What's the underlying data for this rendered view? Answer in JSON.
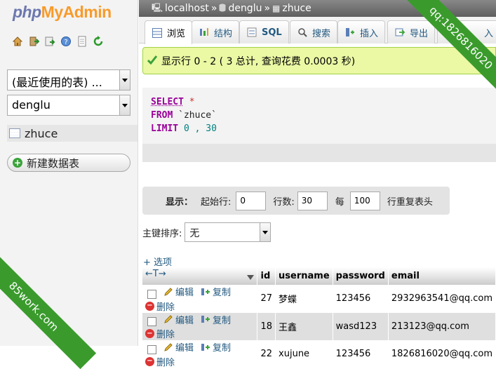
{
  "logo": {
    "php": "php",
    "myadmin": "MyAdmin"
  },
  "sidebar": {
    "icons": [
      "home-icon",
      "exit-icon",
      "query-icon",
      "help-icon",
      "docs-icon",
      "reload-icon"
    ],
    "recent_tables": "(最近使用的表) ...",
    "database": "denglu",
    "table": "zhuce",
    "new_table": "新建数据表"
  },
  "breadcrumb": {
    "server": "localhost",
    "sep1": "»",
    "database": "denglu",
    "sep2": "»",
    "table": "zhuce"
  },
  "tabs": [
    {
      "label": "浏览",
      "icon": "browse-icon"
    },
    {
      "label": "结构",
      "icon": "structure-icon"
    },
    {
      "label": "SQL",
      "icon": "sql-icon"
    },
    {
      "label": "搜索",
      "icon": "search-icon"
    },
    {
      "label": "插入",
      "icon": "insert-icon"
    },
    {
      "label": "导出",
      "icon": "export-icon"
    },
    {
      "label": "入",
      "icon": "import-icon"
    }
  ],
  "success_message": "显示行 0 - 2 ( 3 总计, 查询花费 0.0003 秒)",
  "sql": {
    "select": "SELECT",
    "star": " *",
    "from": "FROM",
    "table": " `zhuce`",
    "limit": "LIMIT",
    "limit_val": " 0 , 30"
  },
  "display": {
    "label": "显示：",
    "start_label": "起始行:",
    "start_value": "0",
    "rows_label": "行数:",
    "rows_value": "30",
    "every_label": "每",
    "every_value": "100",
    "repeat_label": "行重复表头"
  },
  "pk_sort": {
    "label": "主键排序:",
    "value": "无"
  },
  "options_link": "+ 选项",
  "table": {
    "sort_arrows": "←T→",
    "columns": [
      "id",
      "username",
      "password",
      "email"
    ],
    "actions": {
      "edit": "编辑",
      "copy": "复制",
      "delete": "删除"
    },
    "rows": [
      {
        "id": "27",
        "username": "梦蝶",
        "password": "123456",
        "email": "2932963541@qq.com"
      },
      {
        "id": "18",
        "username": "王鑫",
        "password": "wasd123",
        "email": "213123@qq.com"
      },
      {
        "id": "22",
        "username": "xujune",
        "password": "123456",
        "email": "1826816020@qq.com"
      }
    ]
  },
  "watermarks": {
    "top_right": "qq:1826816020",
    "bottom_left": "85work.com"
  },
  "colors": {
    "ribbon": "#3a9b2c",
    "success_bg": "#ebf8a4",
    "sql_keyword": "#990099",
    "logo_php": "#6c78af",
    "logo_admin": "#f89b2b"
  }
}
